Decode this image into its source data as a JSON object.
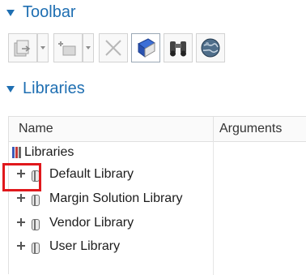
{
  "toolbar": {
    "title": "Toolbar",
    "buttons": [
      {
        "icon": "new-library-icon"
      },
      {
        "icon": "add-item-icon"
      },
      {
        "icon": "delete-icon"
      },
      {
        "icon": "book-icon"
      },
      {
        "icon": "binoculars-icon"
      },
      {
        "icon": "globe-icon"
      }
    ]
  },
  "libraries": {
    "title": "Libraries",
    "columns": {
      "name": "Name",
      "arguments": "Arguments"
    },
    "root": {
      "label": "Libraries"
    },
    "items": [
      {
        "label": "Default Library"
      },
      {
        "label": "Margin Solution Library"
      },
      {
        "label": "Vendor Library"
      },
      {
        "label": "User Library"
      }
    ]
  },
  "colors": {
    "accent": "#1f6fb2",
    "highlight": "#e0181c"
  }
}
